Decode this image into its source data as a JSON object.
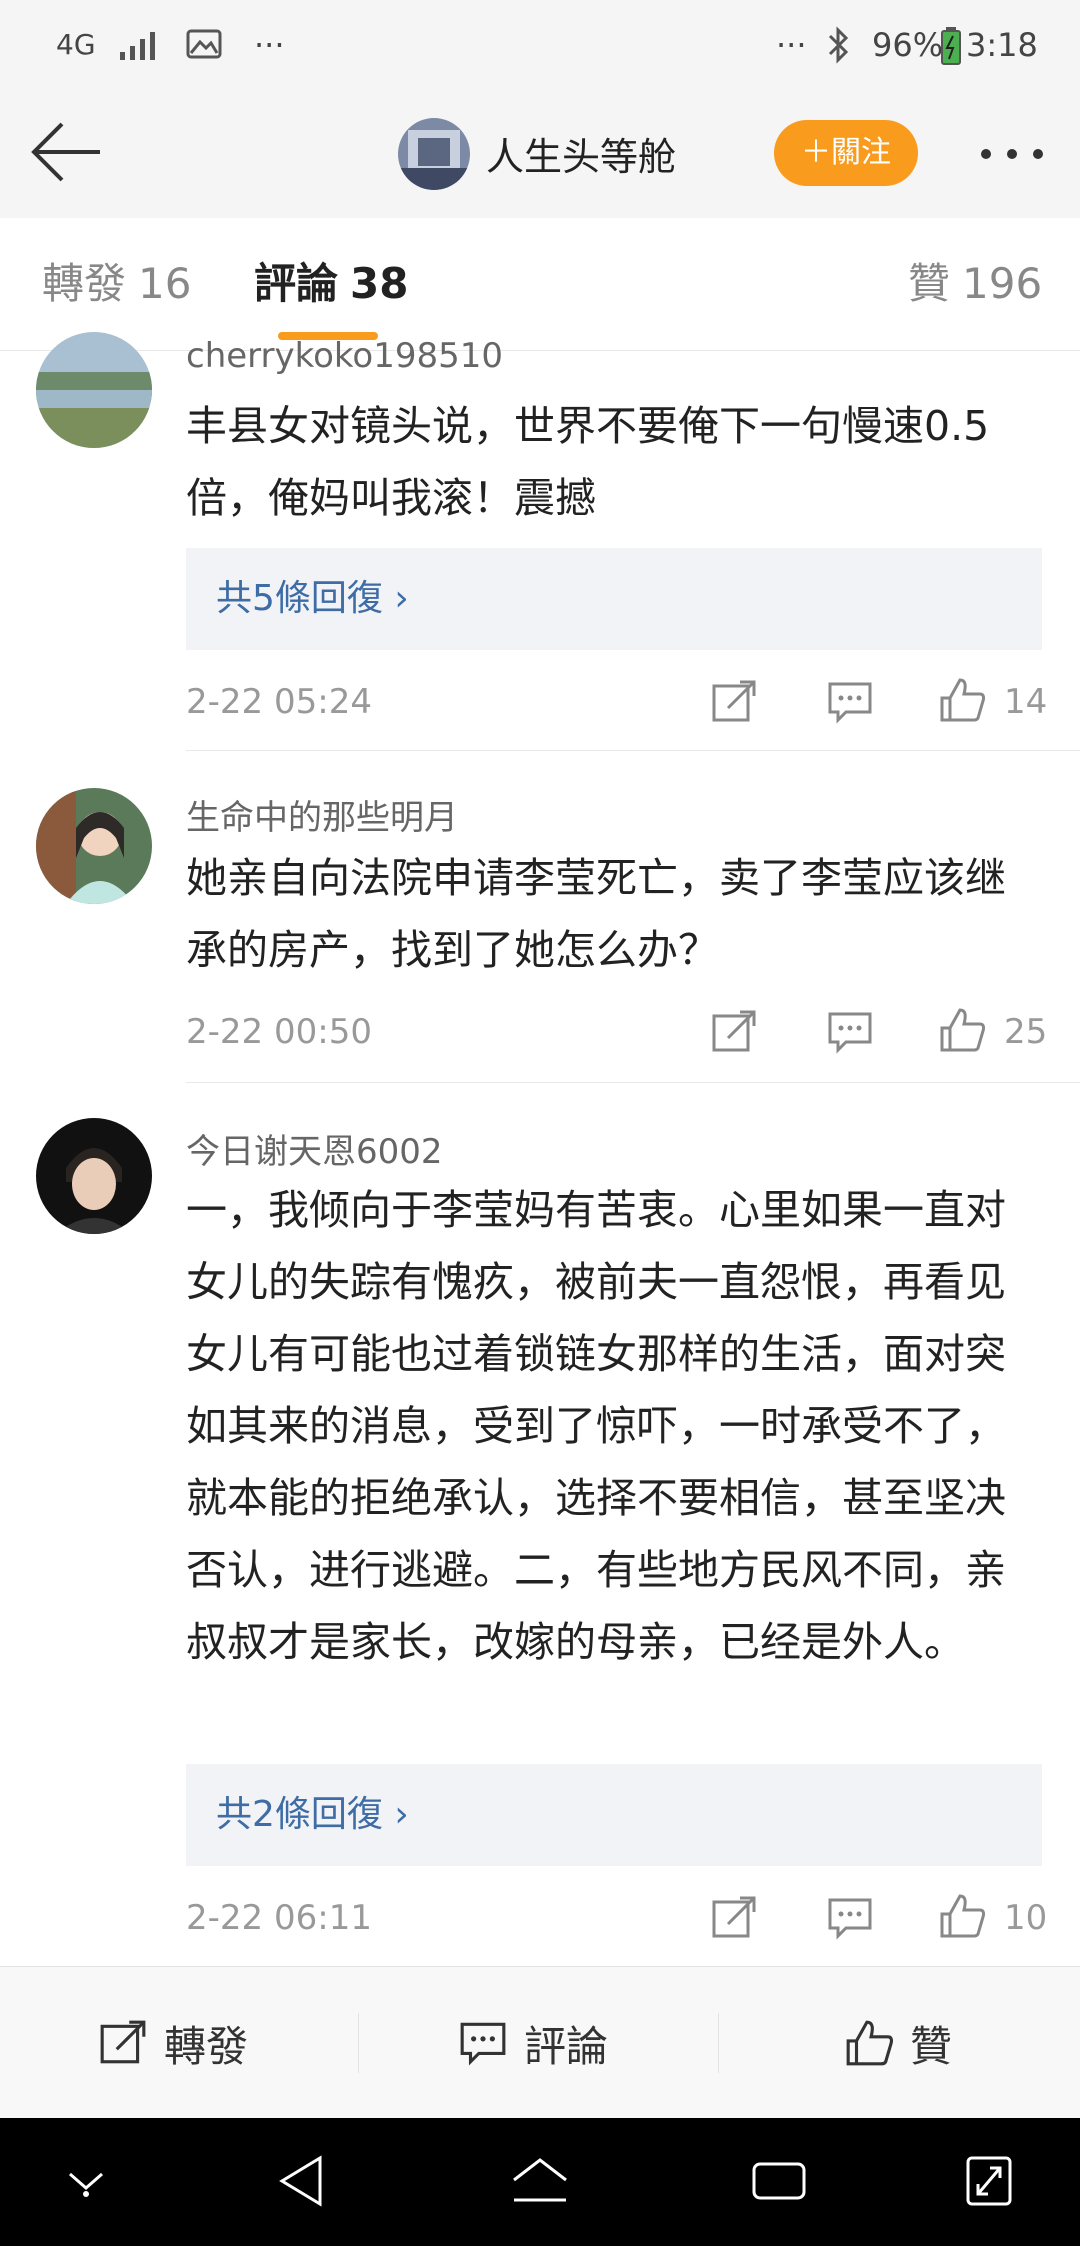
{
  "status_bar": {
    "network": "4G",
    "dots_left": "···",
    "dots_right": "···",
    "battery": "96%",
    "time": "3:18"
  },
  "nav": {
    "title": "人生头等舱",
    "follow_label": "＋關注",
    "back_icon": "back-arrow-icon",
    "more_icon": "more-dots-icon"
  },
  "tabs": [
    {
      "label": "轉發",
      "count": "16"
    },
    {
      "label": "評論",
      "count": "38"
    },
    {
      "label": "贊",
      "count": "196"
    }
  ],
  "comments": [
    {
      "user": "cherrykoko198510",
      "text": "丰县女对镜头说，世界不要俺下一句慢速0.5倍，俺妈叫我滚！震撼",
      "replies": "共5條回復 ›",
      "time": "2-22 05:24",
      "likes": "14"
    },
    {
      "user": "生命中的那些明月",
      "text": "她亲自向法院申请李莹死亡，卖了李莹应该继承的房产，找到了她怎么办？",
      "time": "2-22 00:50",
      "likes": "25"
    },
    {
      "user": "今日谢天恩6002",
      "text": "一，我倾向于李莹妈有苦衷。心里如果一直对女儿的失踪有愧疚，被前夫一直怨恨，再看见女儿有可能也过着锁链女那样的生活，面对突如其来的消息，受到了惊吓，一时承受不了，就本能的拒绝承认，选择不要相信，甚至坚决否认，进行逃避。二，有些地方民风不同，亲叔叔才是家长，改嫁的母亲，已经是外人。",
      "replies": "共2條回復 ›",
      "time": "2-22 06:11",
      "likes": "10"
    }
  ],
  "bottom_bar": {
    "repost": "轉發",
    "comment": "評論",
    "like": "贊"
  },
  "colors": {
    "accent": "#f99b1d",
    "link": "#3e6da6",
    "bar_bg": "#f5f5f5"
  }
}
